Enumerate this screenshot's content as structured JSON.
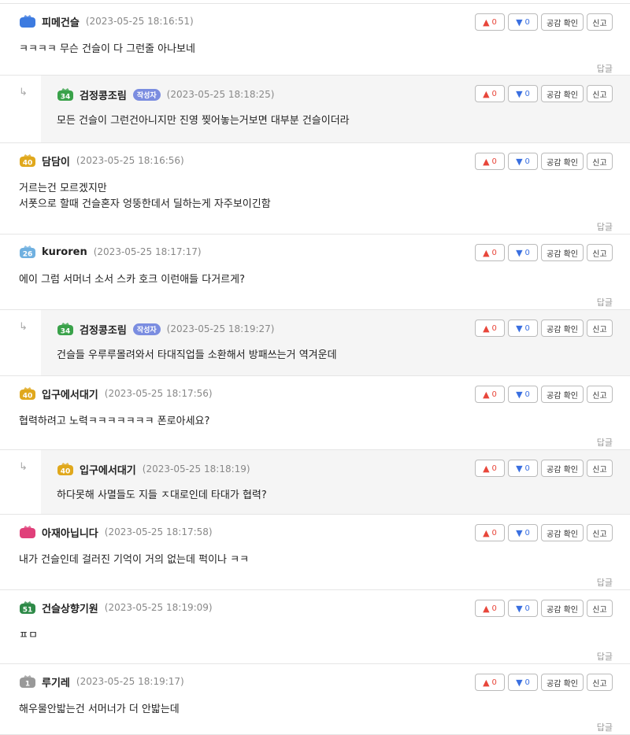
{
  "labels": {
    "empathy_check": "공감 확인",
    "report": "신고",
    "reply": "답글",
    "author_badge": "작성자",
    "reply_arrow": "↳"
  },
  "comments": [
    {
      "nick": "피메건슬",
      "date": "(2023-05-25 18:16:51)",
      "text": "ㅋㅋㅋㅋ 무슨 건슬이 다 그런줄 아나보네",
      "up": "0",
      "down": "0",
      "level": "",
      "level_color": "#3d7be0",
      "reply": false,
      "author": false
    },
    {
      "nick": "검정콩조림",
      "date": "(2023-05-25 18:18:25)",
      "text": "모든 건슬이 그런건아니지만 진영 찢어놓는거보면 대부분 건슬이더라",
      "up": "0",
      "down": "0",
      "level": "34",
      "level_color": "#3aa24a",
      "reply": true,
      "author": true
    },
    {
      "nick": "담담이",
      "date": "(2023-05-25 18:16:56)",
      "text": "거르는건 모르겠지만\n서폿으로 할때 건슬혼자 엉뚱한데서 딜하는게 자주보이긴함",
      "up": "0",
      "down": "0",
      "level": "40",
      "level_color": "#e0a81c",
      "reply": false,
      "author": false
    },
    {
      "nick": "kuroren",
      "date": "(2023-05-25 18:17:17)",
      "text": "에이 그럼 서머너 소서 스카 호크 이런애들 다거르게?",
      "up": "0",
      "down": "0",
      "level": "26",
      "level_color": "#6fb0e0",
      "reply": false,
      "author": false
    },
    {
      "nick": "검정콩조림",
      "date": "(2023-05-25 18:19:27)",
      "text": "건슬들 우루루몰려와서 타대직업들 소환해서 방패쓰는거 역겨운데",
      "up": "0",
      "down": "0",
      "level": "34",
      "level_color": "#3aa24a",
      "reply": true,
      "author": true
    },
    {
      "nick": "입구에서대기",
      "date": "(2023-05-25 18:17:56)",
      "text": "협력하려고 노력ㅋㅋㅋㅋㅋㅋㅋ 폰로아세요?",
      "up": "0",
      "down": "0",
      "level": "40",
      "level_color": "#e0a81c",
      "reply": false,
      "author": false
    },
    {
      "nick": "입구에서대기",
      "date": "(2023-05-25 18:18:19)",
      "text": "하다못해 사멸들도 지들 ㅈ대로인데 타대가 협력?",
      "up": "0",
      "down": "0",
      "level": "40",
      "level_color": "#e0a81c",
      "reply": true,
      "author": false
    },
    {
      "nick": "아재아닙니다",
      "date": "(2023-05-25 18:17:58)",
      "text": "내가 건슬인데 걸러진 기억이 거의 없는데 퍽이나 ㅋㅋ",
      "up": "0",
      "down": "0",
      "level": "",
      "level_color": "#e0407a",
      "reply": false,
      "author": false
    },
    {
      "nick": "건슬상향기원",
      "date": "(2023-05-25 18:19:09)",
      "text": "ㅍㅁ",
      "up": "0",
      "down": "0",
      "level": "51",
      "level_color": "#2e8a48",
      "reply": false,
      "author": false
    },
    {
      "nick": "루기레",
      "date": "(2023-05-25 18:19:17)",
      "text": "해우물안밟는건 서머너가 더 안밟는데",
      "up": "0",
      "down": "0",
      "level": "1",
      "level_color": "#999999",
      "reply": false,
      "author": false
    }
  ]
}
